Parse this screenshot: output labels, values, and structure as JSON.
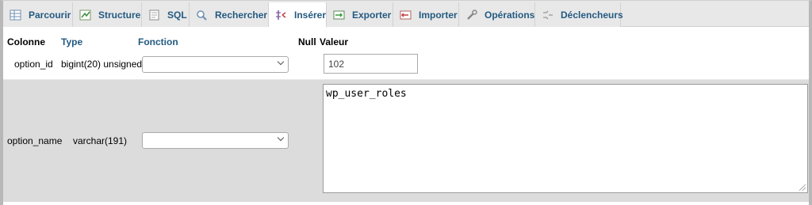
{
  "tabs": [
    {
      "label": "Parcourir",
      "icon": "browse-icon"
    },
    {
      "label": "Structure",
      "icon": "structure-icon"
    },
    {
      "label": "SQL",
      "icon": "sql-icon"
    },
    {
      "label": "Rechercher",
      "icon": "search-icon"
    },
    {
      "label": "Insérer",
      "icon": "insert-icon",
      "active": true
    },
    {
      "label": "Exporter",
      "icon": "export-icon"
    },
    {
      "label": "Importer",
      "icon": "import-icon"
    },
    {
      "label": "Opérations",
      "icon": "operations-icon"
    },
    {
      "label": "Déclencheurs",
      "icon": "triggers-icon"
    }
  ],
  "headers": {
    "column": "Colonne",
    "type": "Type",
    "function": "Fonction",
    "null": "Null",
    "value": "Valeur"
  },
  "rows": [
    {
      "column": "option_id",
      "type": "bigint(20) unsigned",
      "function": "",
      "value": "102"
    },
    {
      "column": "option_name",
      "type": "varchar(191)",
      "function": "",
      "value": "wp_user_roles"
    }
  ],
  "colors": {
    "tab_text": "#235a81",
    "row_alt": "#dcdcdc",
    "tab_bar": "#e8e8e8"
  }
}
